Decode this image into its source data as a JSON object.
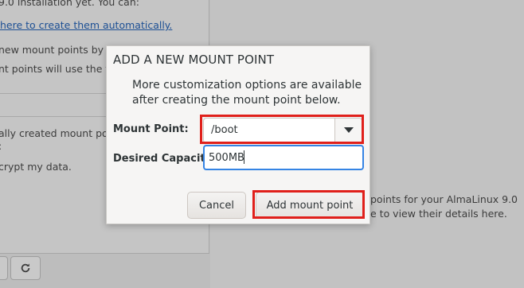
{
  "background": {
    "left_lines": [
      "9.0 installation yet.  You can:",
      "here to create them automatically.",
      "new mount points by cl",
      "nt points will use the fo",
      "ally created mount po",
      ":",
      "crypt my data."
    ],
    "right_lines": [
      "points for your AlmaLinux 9.0",
      "e to view their details here."
    ],
    "toolbar_icons": [
      "minus-icon",
      "refresh-icon"
    ]
  },
  "dialog": {
    "title": "ADD A NEW MOUNT POINT",
    "description": "More customization options are available after creating the mount point below.",
    "mount_point_label": "Mount Point:",
    "mount_point_value": "/boot",
    "capacity_label": "Desired Capacity:",
    "capacity_value": "500MB",
    "cancel_label": "Cancel",
    "add_label": "Add mount point"
  },
  "colors": {
    "highlight": "#e0201b",
    "focus": "#3584e4",
    "link": "#1c4f94"
  }
}
